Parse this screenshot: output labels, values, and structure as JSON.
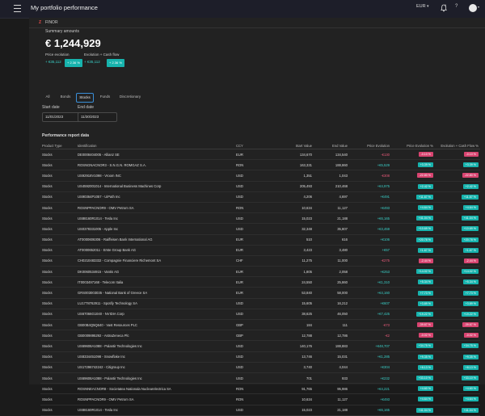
{
  "header": {
    "title": "My portfolio performance",
    "currency": "EUR",
    "notif_count": "1"
  },
  "tab": {
    "label": "FINOR"
  },
  "summary": {
    "label": "Summary amounts",
    "value": "€ 1,244,929",
    "price_evolution_label": "Price evolution",
    "price_evolution_value": "+ €35,112",
    "price_evolution_pct": "+ 2.36 %",
    "cashflow_label": "Evolution + Cash flow",
    "cashflow_value": "+ €35,112",
    "cashflow_pct": "+ 2.36 %"
  },
  "filters": [
    "All",
    "Bonds",
    "Stocks",
    "Funds",
    "Discretionary"
  ],
  "selected_filter": "Stocks",
  "dates": {
    "start_label": "Start date",
    "start_value": "11/01/2023",
    "end_label": "End date",
    "end_value": "11/30/2023"
  },
  "report": {
    "title": "Performance report data"
  },
  "table": {
    "headers": [
      "Product Type",
      "Identification",
      "CCY",
      "Start Value",
      "End Value",
      "Price Evolution",
      "Price Evolution %",
      "Evolution + Cash Flow %"
    ],
    "rows": [
      [
        "Stocks",
        "DE0008404005 - Allianz SE",
        "EUR",
        "134,670",
        "134,540",
        "-€130",
        "-0.10 %",
        "-0.10 %"
      ],
      [
        "Stocks",
        "ROSNGNACNOR3 - S.N.G.N. ROMGAZ S.A.",
        "RON",
        "163,331",
        "188,860",
        "+€5,529",
        "+3.39 %",
        "+3.39 %"
      ],
      [
        "Stocks",
        "US92918V1098 - Vroom INC",
        "USD",
        "1,351",
        "1,043",
        "-€308",
        "-22.80 %",
        "-22.80 %"
      ],
      [
        "Stocks",
        "US4592001014 - International Business Machines Corp",
        "USD",
        "205,493",
        "210,468",
        "+€4,975",
        "+2.42 %",
        "+2.42 %"
      ],
      [
        "Stocks",
        "US90364P1057 - UiPath Inc",
        "USD",
        "4,206",
        "4,697",
        "+€491",
        "+11.67 %",
        "+11.67 %"
      ],
      [
        "Stocks",
        "ROSNPPACNOR9 - OMV Petrom SA",
        "RON",
        "10,634",
        "11,127",
        "+€493",
        "+4.64 %",
        "+4.64 %"
      ],
      [
        "Stocks",
        "US88160R1014 - Tesla Inc",
        "USD",
        "15,023",
        "21,188",
        "+€6,165",
        "+41.04 %",
        "+41.04 %"
      ],
      [
        "Stocks",
        "US0378331005 - Apple Inc",
        "USD",
        "32,348",
        "35,807",
        "+€3,459",
        "+10.69 %",
        "+10.69 %"
      ],
      [
        "Stocks",
        "AT0000606306 - Raiffeisen Bank International AG",
        "EUR",
        "510",
        "616",
        "+€106",
        "+20.78 %",
        "+20.78 %"
      ],
      [
        "Stocks",
        "AT0000652011 - Erste Group Bank AG",
        "EUR",
        "3,423",
        "3,480",
        "+€57",
        "+1.67 %",
        "+1.67 %"
      ],
      [
        "Stocks",
        "CH0210483332 - Compagnie Financiere Richemont SA",
        "CHF",
        "11,275",
        "11,000",
        "-€275",
        "-2.44 %",
        "-2.44 %"
      ],
      [
        "Stocks",
        "DK0060534915 - Vantis AG",
        "EUR",
        "1,805",
        "2,058",
        "+€253",
        "+14.02 %",
        "+14.02 %"
      ],
      [
        "Stocks",
        "IT0003497168 - Telecom Italia",
        "EUR",
        "24,550",
        "25,860",
        "+€1,310",
        "+5.34 %",
        "+5.34 %"
      ],
      [
        "Stocks",
        "GRS003003035 - National Bank of Greece SA",
        "EUR",
        "53,840",
        "58,000",
        "+€4,160",
        "+7.73 %",
        "+7.73 %"
      ],
      [
        "Stocks",
        "LU1778762911 - Spotify Technology SA",
        "USD",
        "15,605",
        "16,212",
        "+€607",
        "+3.89 %",
        "+3.89 %"
      ],
      [
        "Stocks",
        "US67066G1040 - NVIDIA Corp",
        "USD",
        "38,625",
        "46,050",
        "+€7,425",
        "+19.22 %",
        "+19.22 %"
      ],
      [
        "Stocks",
        "GB00B4Q5Q640 - Vast Resources PLC",
        "GBP",
        "184",
        "111",
        "-€73",
        "-39.67 %",
        "-39.67 %"
      ],
      [
        "Stocks",
        "GB0009895292 - AstraZeneca Plc",
        "GBP",
        "12,788",
        "12,786",
        "-€2",
        "-0.02 %",
        "-0.02 %"
      ],
      [
        "Stocks",
        "US69608A1088 - Palantir Technologies Inc",
        "USD",
        "140,176",
        "188,883",
        "+€48,707",
        "+34.75 %",
        "+34.75 %"
      ],
      [
        "Stocks",
        "US8334451098 - Snowflake Inc",
        "USD",
        "13,746",
        "15,031",
        "+€1,285",
        "+9.35 %",
        "+9.35 %"
      ],
      [
        "Stocks",
        "US17296742242 - Citigroup Inc",
        "USD",
        "3,740",
        "4,044",
        "+€304",
        "+8.13 %",
        "+8.13 %"
      ],
      [
        "Stocks",
        "US69608A1088 - Palantir Technologies Inc",
        "USD",
        "701",
        "933",
        "+€232",
        "+33.10 %",
        "+33.10 %"
      ],
      [
        "Stocks",
        "ROSNNEACNOR8 - Societatea Nationala Nuclearelectrica SA",
        "RON",
        "91,765",
        "95,986",
        "+€4,221",
        "+4.60 %",
        "+4.60 %"
      ],
      [
        "Stocks",
        "ROSNPPACNOR9 - OMV Petrom SA",
        "RON",
        "10,634",
        "11,127",
        "+€493",
        "+4.64 %",
        "+4.64 %"
      ],
      [
        "Stocks",
        "US88160R1014 - Tesla Inc",
        "USD",
        "15,023",
        "21,188",
        "+€6,165",
        "+41.04 %",
        "+41.04 %"
      ]
    ]
  }
}
